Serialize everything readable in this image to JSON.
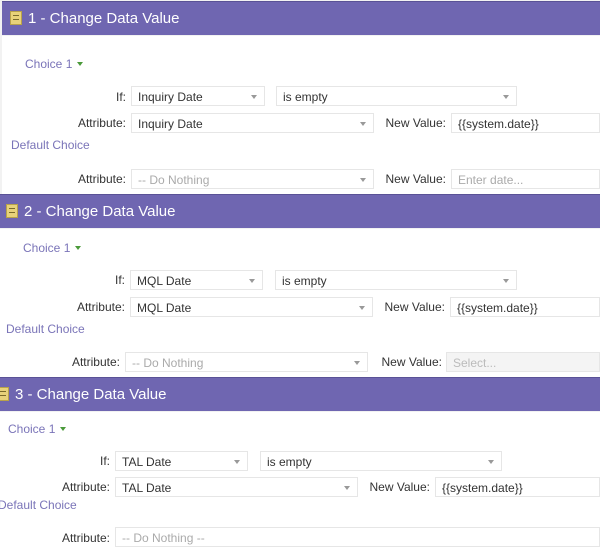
{
  "steps": [
    {
      "title": "1 - Change Data Value",
      "choice_label": "Choice 1",
      "if_label": "If:",
      "if_field": "Inquiry Date",
      "if_operator": "is empty",
      "attr_label": "Attribute:",
      "attr_value": "Inquiry Date",
      "new_value_label": "New Value:",
      "new_value": "{{system.date}}",
      "default_label": "Default Choice",
      "default_attr_label": "Attribute:",
      "default_attr_value": "-- Do Nothing",
      "default_new_value_label": "New Value:",
      "default_new_value_placeholder": "Enter date..."
    },
    {
      "title": "2 - Change Data Value",
      "choice_label": "Choice 1",
      "if_label": "If:",
      "if_field": "MQL Date",
      "if_operator": "is empty",
      "attr_label": "Attribute:",
      "attr_value": "MQL Date",
      "new_value_label": "New Value:",
      "new_value": "{{system.date}}",
      "default_label": "Default Choice",
      "default_attr_label": "Attribute:",
      "default_attr_value": "-- Do Nothing",
      "default_new_value_label": "New Value:",
      "default_new_value_placeholder": "Select..."
    },
    {
      "title": "3 - Change Data Value",
      "choice_label": "Choice 1",
      "if_label": "If:",
      "if_field": "TAL Date",
      "if_operator": "is empty",
      "attr_label": "Attribute:",
      "attr_value": "TAL Date",
      "new_value_label": "New Value:",
      "new_value": "{{system.date}}",
      "default_label": "Default Choice",
      "default_attr_label": "Attribute:",
      "default_attr_value": "-- Do Nothing --"
    }
  ],
  "colors": {
    "header_bg": "#6f66b1",
    "link": "#7a74b8",
    "caret_green": "#4a9a3a"
  },
  "icons": {
    "step_icon": "flow-step-icon",
    "choice_caret": "caret-down-icon",
    "select_arrow": "dropdown-arrow-icon"
  }
}
